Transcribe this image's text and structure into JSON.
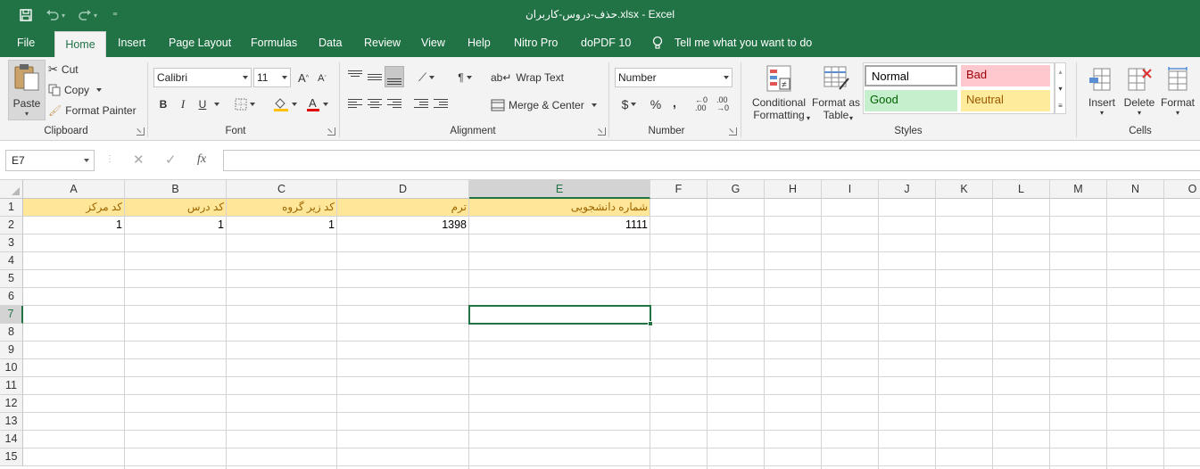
{
  "window": {
    "title": "حذف-دروس-کاربران.xlsx  -  Excel"
  },
  "quick_access": {
    "customize_label": "⁼"
  },
  "tabs": [
    {
      "label": "File"
    },
    {
      "label": "Home"
    },
    {
      "label": "Insert"
    },
    {
      "label": "Page Layout"
    },
    {
      "label": "Formulas"
    },
    {
      "label": "Data"
    },
    {
      "label": "Review"
    },
    {
      "label": "View"
    },
    {
      "label": "Help"
    },
    {
      "label": "Nitro Pro"
    },
    {
      "label": "doPDF 10"
    },
    {
      "label": "Tell me what you want to do"
    }
  ],
  "clipboard": {
    "paste": "Paste",
    "cut": "Cut",
    "copy": "Copy",
    "format_painter": "Format Painter",
    "label": "Clipboard"
  },
  "font": {
    "name": "Calibri",
    "size": "11",
    "bold": "B",
    "italic": "I",
    "underline": "U",
    "label": "Font"
  },
  "alignment": {
    "wrap": "Wrap Text",
    "merge": "Merge & Center",
    "label": "Alignment"
  },
  "number": {
    "format": "Number",
    "currency": "$",
    "percent": "%",
    "comma": ",",
    "label": "Number"
  },
  "styles": {
    "conditional_1": "Conditional",
    "conditional_2": "Formatting",
    "format_table_1": "Format as",
    "format_table_2": "Table",
    "normal": "Normal",
    "bad": "Bad",
    "good": "Good",
    "neutral": "Neutral",
    "label": "Styles"
  },
  "cells": {
    "insert": "Insert",
    "delete": "Delete",
    "format": "Format",
    "label": "Cells"
  },
  "formula_bar": {
    "name_box": "E7",
    "fx": "fx",
    "value": ""
  },
  "columns": [
    "A",
    "B",
    "C",
    "D",
    "E",
    "F",
    "G",
    "H",
    "I",
    "J",
    "K",
    "L",
    "M",
    "N",
    "O"
  ],
  "rows": [
    "1",
    "2",
    "3",
    "4",
    "5",
    "6",
    "7",
    "8",
    "9",
    "10",
    "11",
    "12",
    "13",
    "14",
    "15"
  ],
  "sheet": {
    "row1": [
      "کد مرکز",
      "کد درس",
      "کد زیر گروه",
      "ترم",
      "شماره دانشجویی"
    ],
    "row2": [
      "1",
      "1",
      "1",
      "1398",
      "1111"
    ]
  },
  "active_cell": "E7",
  "colors": {
    "accent": "#217346",
    "header_fill": "#ffe699",
    "header_text": "#9c6500"
  }
}
